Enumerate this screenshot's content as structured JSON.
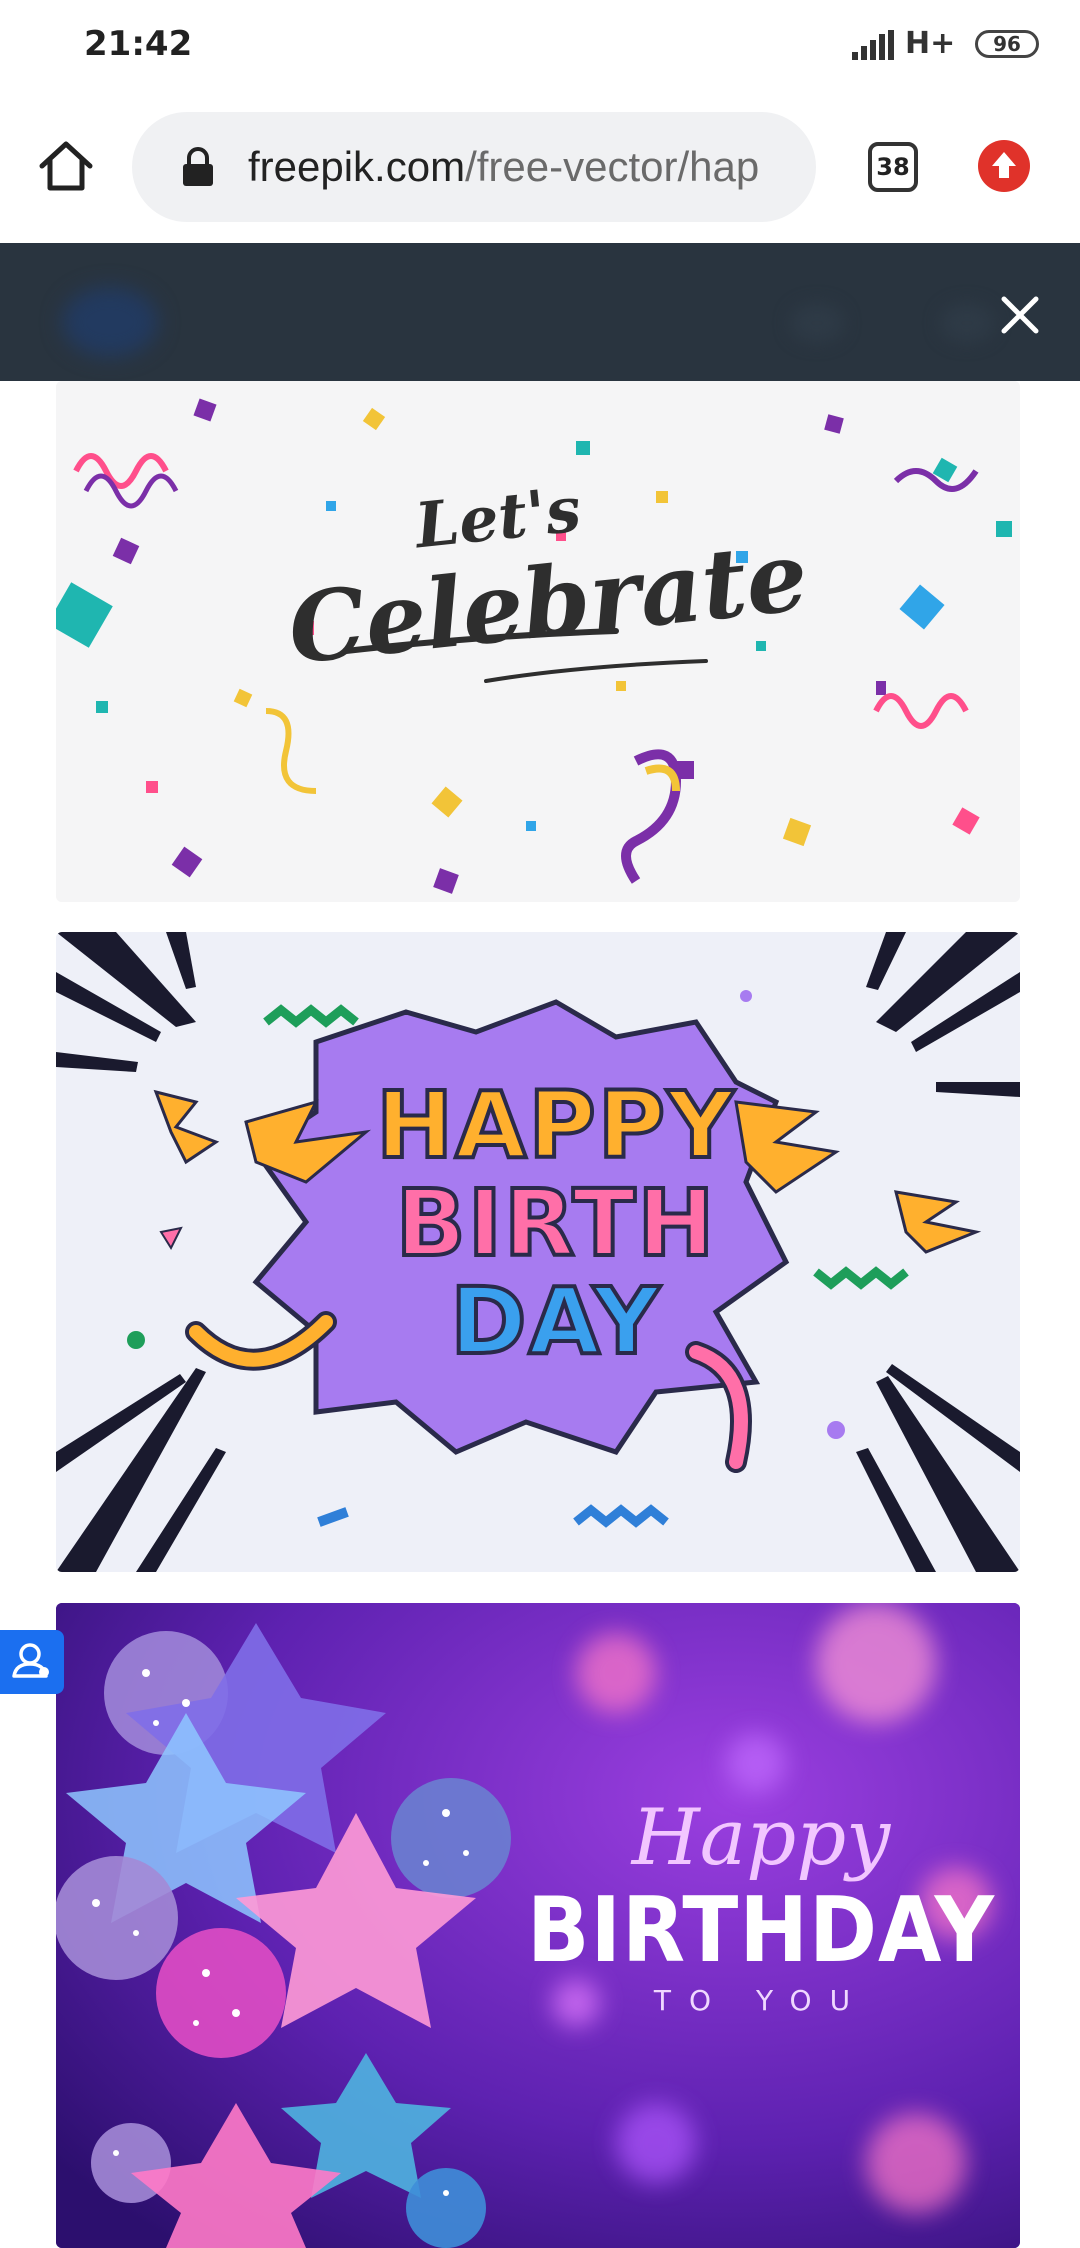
{
  "status_bar": {
    "time": "21:42",
    "network": "H+",
    "battery_level": "96"
  },
  "browser": {
    "url_domain": "freepik.com",
    "url_path": "/free-vector/hap",
    "tab_count": "38"
  },
  "cards": {
    "celebrate": {
      "line1": "Let's",
      "line2": "Celebrate"
    },
    "comic": {
      "line1": "HAPPY",
      "line2": "BIRTH",
      "line3": "DAY"
    },
    "balloons": {
      "line1": "Happy",
      "line2": "BIRTHDAY",
      "line3": "TO YOU"
    }
  },
  "colors": {
    "banner_bg": "#29343f",
    "update_button": "#e0322a",
    "side_tab": "#1b6ff0",
    "card3_bg": "#5a1fa8"
  },
  "icons": {
    "home": "home-icon",
    "lock": "lock-icon",
    "update": "arrow-up-icon",
    "close": "close-icon",
    "side_tab": "user-icon"
  }
}
